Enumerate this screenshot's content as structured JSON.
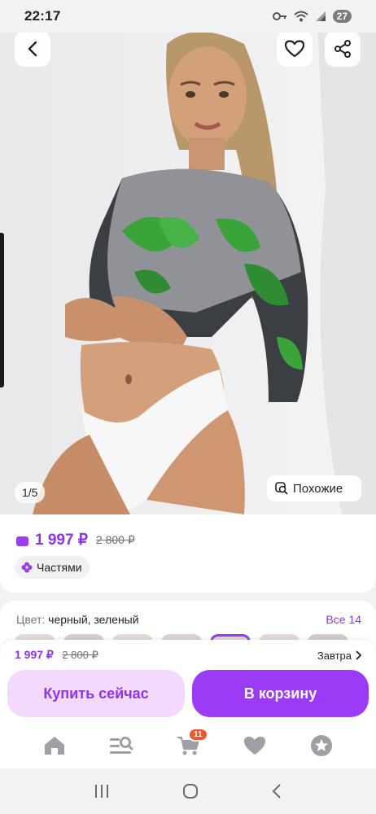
{
  "status": {
    "time": "22:17",
    "battery": "27"
  },
  "product": {
    "image_counter": "1/5",
    "similar_label": "Похожие",
    "price": "1 997 ₽",
    "old_price": "2 800 ₽",
    "installments_label": "Частями",
    "color_key": "Цвет:",
    "color_value": "черный, зеленый",
    "color_all": "Все 14"
  },
  "purchase": {
    "price": "1 997 ₽",
    "old_price": "2 800 ₽",
    "delivery": "Завтра",
    "buy_now_label": "Купить сейчас",
    "add_to_cart_label": "В корзину"
  },
  "nav": {
    "items": [
      {
        "icon": "home-icon"
      },
      {
        "icon": "catalog-search-icon"
      },
      {
        "icon": "cart-icon",
        "badge": "11"
      },
      {
        "icon": "heart-icon"
      },
      {
        "icon": "profile-star-icon"
      }
    ]
  },
  "colors": {
    "accent": "#8d35e8",
    "accent_button": "#9b3bf5",
    "light_button": "#f3d9fb",
    "badge": "#f2562f"
  }
}
